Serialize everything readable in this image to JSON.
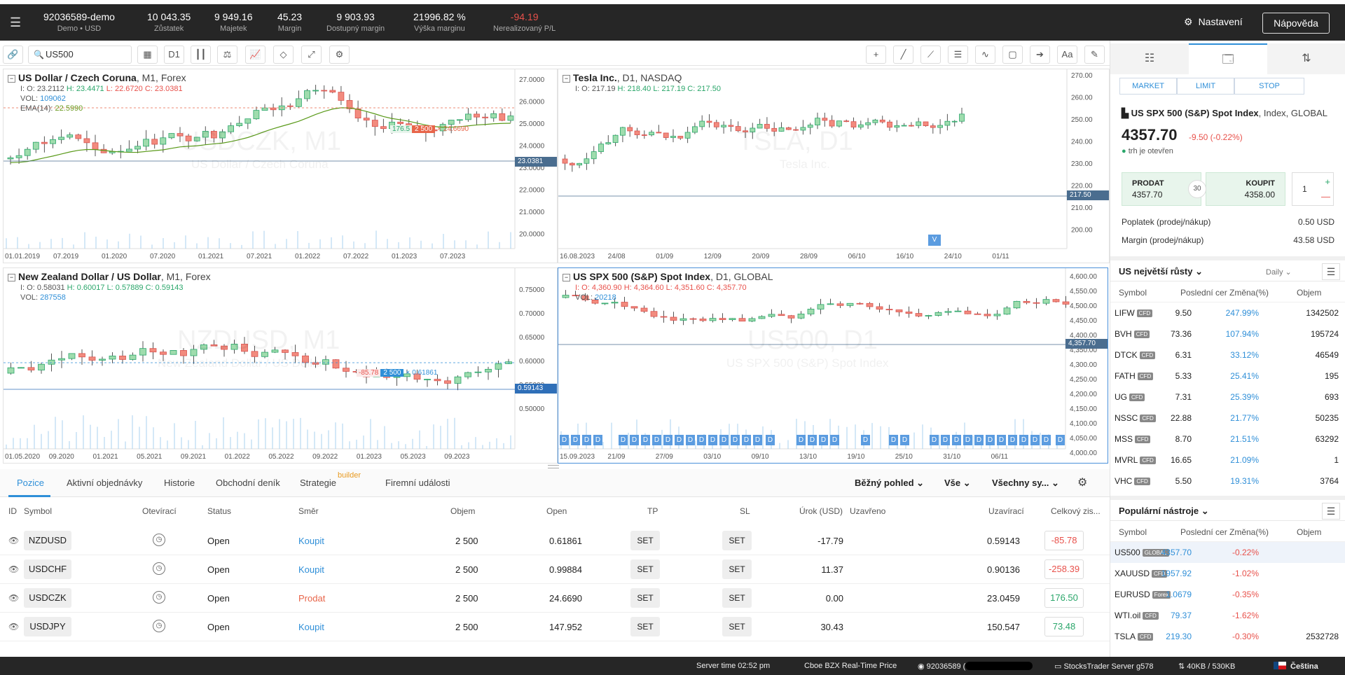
{
  "account": {
    "id": "92036589-demo",
    "sub": "Demo • USD",
    "stats": [
      {
        "value": "10 043.35",
        "label": "Zůstatek"
      },
      {
        "value": "9 949.16",
        "label": "Majetek"
      },
      {
        "value": "45.23",
        "label": "Margin"
      },
      {
        "value": "9 903.93",
        "label": "Dostupný margin"
      },
      {
        "value": "21996.82 %",
        "label": "Výška marginu"
      },
      {
        "value": "-94.19",
        "label": "Nerealizovaný P/L"
      }
    ],
    "settings_label": "Nastavení",
    "help_label": "Nápověda"
  },
  "toolbar": {
    "search_value": "US500",
    "timeframe": "D1",
    "text_tool": "Aa"
  },
  "charts": [
    {
      "title": "US Dollar / Czech Coruna",
      "sub": ",  M1,  Forex",
      "o": "I: O: 23.2112",
      "h": "H: 23.4471",
      "l": "L: 22.6720",
      "c": "C: 23.0381",
      "vol": "109062",
      "ema_label": "EMA(14):",
      "ema": "22.5990",
      "wm1": "USDCZK, M1",
      "wm2": "US Dollar / Czech Coruna",
      "price_tag": "23.0381",
      "ticks": [
        "27.0000",
        "26.0000",
        "25.0000",
        "24.0000",
        "23.0000",
        "22.0000",
        "21.0000",
        "20.0000"
      ],
      "x_labels": [
        "01.01.2019",
        "07.2019",
        "01.2020",
        "07.2020",
        "01.2021",
        "07.2021",
        "01.2022",
        "07.2022",
        "01.2023",
        "07.2023"
      ],
      "order_tag": "2 500",
      "order_tag_l": "176.5",
      "order_tag_r": "24.6690"
    },
    {
      "title": "Tesla Inc.",
      "sub": ",  D1,  NASDAQ",
      "o": "I: O: 217.19",
      "h": "H: 218.40",
      "l": "L: 217.19",
      "c": "C: 217.50",
      "wm1": "TSLA, D1",
      "wm2": "Tesla Inc.",
      "price_tag": "217.50",
      "ticks": [
        "270.00",
        "260.00",
        "250.00",
        "240.00",
        "230.00",
        "220.00",
        "210.00",
        "200.00"
      ],
      "x_labels": [
        "16.08.2023",
        "24/08",
        "01/09",
        "12/09",
        "20/09",
        "28/09",
        "06/10",
        "16/10",
        "24/10",
        "01/11"
      ],
      "marker": "V"
    },
    {
      "title": "New Zealand Dollar / US Dollar",
      "sub": ",  M1,  Forex",
      "o": "I: O: 0.58031",
      "h": "H: 0.60017",
      "l": "L: 0.57889",
      "c": "C: 0.59143",
      "vol": "287558",
      "wm1": "NZDUSD, M1",
      "wm2": "New Zealand Dollar / US Dollar",
      "price_tag": "0.59143",
      "ticks": [
        "0.75000",
        "0.70000",
        "0.65000",
        "0.60000",
        "0.55000",
        "0.50000"
      ],
      "x_labels": [
        "01.05.2020",
        "09.2020",
        "01.2021",
        "05.2021",
        "09.2021",
        "01.2022",
        "05.2022",
        "09.2022",
        "01.2023",
        "05.2023",
        "09.2023"
      ],
      "order_tag": "2 500",
      "order_tag_l": "-85.78",
      "order_tag_r": "0.61861"
    },
    {
      "title": "US SPX 500 (S&P) Spot Index",
      "sub": ",  D1,  GLOBAL",
      "o": "I: O: 4,360.90",
      "h": "H: 4,364.60",
      "l": "L: 4,351.60",
      "c": "C: 4,357.70",
      "vol": "20218",
      "wm1": "US500, D1",
      "wm2": "US SPX 500 (S&P) Spot Index",
      "price_tag": "4,357.70",
      "ticks": [
        "4,600.00",
        "4,550.00",
        "4,500.00",
        "4,450.00",
        "4,400.00",
        "4,350.00",
        "4,300.00",
        "4,250.00",
        "4,200.00",
        "4,150.00",
        "4,100.00",
        "4,050.00",
        "4,000.00"
      ],
      "x_labels": [
        "15.09.2023",
        "21/09",
        "27/09",
        "03/10",
        "09/10",
        "13/10",
        "19/10",
        "25/10",
        "31/10",
        "06/11"
      ],
      "div_marker": "D"
    }
  ],
  "bottom": {
    "tabs": [
      "Pozice",
      "Aktivní objednávky",
      "Historie",
      "Obchodní deník",
      "Strategie",
      "Firemní události"
    ],
    "builder": "builder",
    "view": "Běžný pohled",
    "filter1": "Vše",
    "filter2": "Všechny sy...",
    "columns": [
      "ID",
      "Symbol",
      "Otevírací",
      "Status",
      "Směr",
      "Objem",
      "Open",
      "TP",
      "SL",
      "Úrok (USD)",
      "Uzavřeno",
      "Uzavírací",
      "Celkový zis..."
    ],
    "set_label": "SET",
    "rows": [
      {
        "symbol": "NZDUSD",
        "status": "Open",
        "dir": "Koupit",
        "dir_type": "buy",
        "vol": "2 500",
        "open": "0.61861",
        "swap": "-17.79",
        "close": "0.59143",
        "pl": "-85.78",
        "pl_type": "neg"
      },
      {
        "symbol": "USDCHF",
        "status": "Open",
        "dir": "Koupit",
        "dir_type": "buy",
        "vol": "2 500",
        "open": "0.99884",
        "swap": "11.37",
        "close": "0.90136",
        "pl": "-258.39",
        "pl_type": "neg"
      },
      {
        "symbol": "USDCZK",
        "status": "Open",
        "dir": "Prodat",
        "dir_type": "sell",
        "vol": "2 500",
        "open": "24.6690",
        "swap": "0.00",
        "close": "23.0459",
        "pl": "176.50",
        "pl_type": "pos"
      },
      {
        "symbol": "USDJPY",
        "status": "Open",
        "dir": "Koupit",
        "dir_type": "buy",
        "vol": "2 500",
        "open": "147.952",
        "swap": "30.43",
        "close": "150.547",
        "pl": "73.48",
        "pl_type": "pos"
      }
    ]
  },
  "status_bar": {
    "server_time": "Server time 02:52 pm",
    "feed": "Cboe BZX Real-Time Price",
    "user": "92036589 (",
    "server": "StocksTrader Server g578",
    "traffic": "40KB / 530KB",
    "language": "Čeština"
  },
  "right_panel": {
    "order_types": [
      "MARKET",
      "LIMIT",
      "STOP"
    ],
    "instrument": {
      "name": "US SPX 500 (S&P) Spot Index",
      "meta": ", Index, GLOBAL",
      "price": "4357.70",
      "change": "-9.50 (-0.22%)",
      "market_status": "trh je otevřen"
    },
    "sell_label": "PRODAT",
    "sell_price": "4357.70",
    "buy_label": "KOUPIT",
    "buy_price": "4358.00",
    "spread": "30",
    "qty": "1",
    "fee_label": "Poplatek (prodej/nákup)",
    "fee_value": "0.50 USD",
    "margin_label": "Margin (prodej/nákup)",
    "margin_value": "43.58 USD",
    "gainers": {
      "title": "US největší růsty",
      "period": "Daily",
      "columns": [
        "Symbol",
        "Poslední cer",
        "Změna(%)",
        "Objem"
      ],
      "rows": [
        {
          "s": "LIFW",
          "b": "CFD",
          "p": "9.50",
          "c": "247.99%",
          "v": "1342502"
        },
        {
          "s": "BVH",
          "b": "CFD",
          "p": "73.36",
          "c": "107.94%",
          "v": "195724"
        },
        {
          "s": "DTCK",
          "b": "CFD",
          "p": "6.31",
          "c": "33.12%",
          "v": "46549"
        },
        {
          "s": "FATH",
          "b": "CFD",
          "p": "5.33",
          "c": "25.41%",
          "v": "195"
        },
        {
          "s": "UG",
          "b": "CFD",
          "p": "7.31",
          "c": "25.39%",
          "v": "693"
        },
        {
          "s": "NSSC",
          "b": "CFD",
          "p": "22.88",
          "c": "21.77%",
          "v": "50235"
        },
        {
          "s": "MSS",
          "b": "CFD",
          "p": "8.70",
          "c": "21.51%",
          "v": "63292"
        },
        {
          "s": "MVRL",
          "b": "CFD",
          "p": "16.65",
          "c": "21.09%",
          "v": "1"
        },
        {
          "s": "VHC",
          "b": "CFD",
          "p": "5.50",
          "c": "19.31%",
          "v": "3764"
        }
      ]
    },
    "popular": {
      "title": "Populární nástroje",
      "columns": [
        "Symbol",
        "Poslední cer",
        "Změna(%)",
        "Objem"
      ],
      "rows": [
        {
          "s": "US500",
          "b": "GLOBAL",
          "p": "4357.70",
          "c": "-0.22%",
          "v": ""
        },
        {
          "s": "XAUUSD",
          "b": "CFD",
          "p": "1957.92",
          "c": "-1.02%",
          "v": ""
        },
        {
          "s": "EURUSD",
          "b": "Forex",
          "p": "1.0679",
          "c": "-0.35%",
          "v": ""
        },
        {
          "s": "WTI.oil",
          "b": "CFD",
          "p": "79.37",
          "c": "-1.62%",
          "v": ""
        },
        {
          "s": "TSLA",
          "b": "CFD",
          "p": "219.30",
          "c": "-0.30%",
          "v": "2532728"
        }
      ]
    }
  }
}
